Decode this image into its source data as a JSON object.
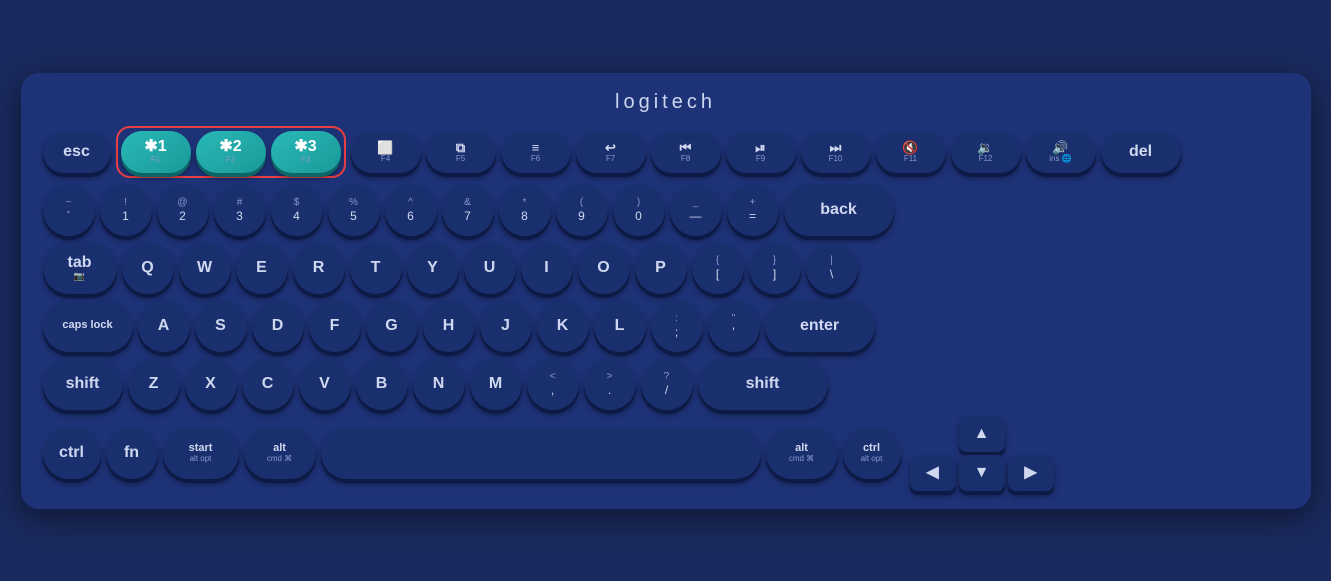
{
  "brand": "logitech",
  "colors": {
    "bg": "#1a2a5e",
    "key_bg": "#1a2f6e",
    "key_shadow": "#0d1a45",
    "bt_key": "#1a9999",
    "highlight_border": "#e84040",
    "key_text": "#d0d8f0",
    "key_sub": "#8899cc"
  },
  "rows": {
    "fn_row": {
      "keys": [
        {
          "label": "esc",
          "sub": ""
        },
        {
          "label": "✱1",
          "sub": "F1",
          "bt": true
        },
        {
          "label": "✱2",
          "sub": "F2",
          "bt": true
        },
        {
          "label": "✱3",
          "sub": "F3",
          "bt": true
        },
        {
          "label": "⬜",
          "sub": "F4"
        },
        {
          "label": "⧉",
          "sub": "F5"
        },
        {
          "label": "≡",
          "sub": "F6"
        },
        {
          "label": "↩",
          "sub": "F7"
        },
        {
          "label": "⏮",
          "sub": "F8"
        },
        {
          "label": "⏯",
          "sub": "F9"
        },
        {
          "label": "⏭",
          "sub": "F10"
        },
        {
          "label": "🔇",
          "sub": "F11"
        },
        {
          "label": "🔉",
          "sub": "F12"
        },
        {
          "label": "🔊",
          "sub": ""
        },
        {
          "label": "del"
        }
      ]
    },
    "num_row": {
      "keys": [
        {
          "top": "~",
          "bot": "`"
        },
        {
          "top": "!",
          "bot": "1"
        },
        {
          "top": "@",
          "bot": "2"
        },
        {
          "top": "#",
          "bot": "3"
        },
        {
          "top": "$",
          "bot": "4"
        },
        {
          "top": "%",
          "bot": "5"
        },
        {
          "top": "^",
          "bot": "6"
        },
        {
          "top": "&",
          "bot": "7"
        },
        {
          "top": "*",
          "bot": "8"
        },
        {
          "top": "(",
          "bot": "9"
        },
        {
          "top": ")",
          "bot": "0"
        },
        {
          "top": "_",
          "bot": "—"
        },
        {
          "top": "+",
          "bot": "="
        },
        {
          "label": "back"
        }
      ]
    }
  },
  "keys": {
    "esc": "esc",
    "bt1": "✱1",
    "bt1_sub": "F1",
    "bt2": "✱2",
    "bt2_sub": "F2",
    "bt3": "✱3",
    "bt3_sub": "F3",
    "back": "back",
    "tab": "tab",
    "caps_lock": "caps lock",
    "enter": "enter",
    "shift_l": "shift",
    "shift_r": "shift",
    "ctrl": "ctrl",
    "fn": "fn",
    "start": "start",
    "start_sub": "alt opt",
    "alt": "alt",
    "alt_sub": "cmd ⌘",
    "alt_r": "alt",
    "alt_r_sub": "cmd ⌘",
    "ctrl_r": "ctrl",
    "ctrl_r_sub": "alt opt",
    "del": "del",
    "ins": "ins"
  }
}
